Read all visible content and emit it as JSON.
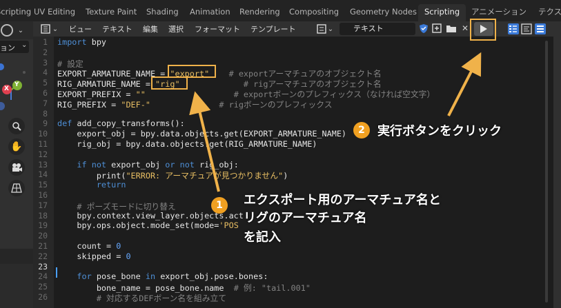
{
  "workspace_tabs": [
    {
      "label": "Scripting",
      "active": false
    },
    {
      "label": "UV Editing",
      "active": false
    },
    {
      "label": "Texture Paint",
      "active": false
    },
    {
      "label": "Shading",
      "active": false
    },
    {
      "label": "Animation",
      "active": false
    },
    {
      "label": "Rendering",
      "active": false
    },
    {
      "label": "Compositing",
      "active": false
    },
    {
      "label": "Geometry Nodes",
      "active": false
    },
    {
      "label": "Scripting",
      "active": true
    },
    {
      "label": "アニメーション",
      "active": false
    },
    {
      "label": "テクス",
      "active": false
    }
  ],
  "left_panel": {
    "mode_label": "ョン",
    "axis_labels": [
      "X",
      "Y"
    ]
  },
  "editor_menu": [
    "ビュー",
    "テキスト",
    "編集",
    "選択",
    "フォーマット",
    "テンプレート"
  ],
  "text_name": "テキスト",
  "code_lines": [
    {
      "n": "1",
      "html": "<span class='kw'>import</span> bpy"
    },
    {
      "n": "2",
      "html": ""
    },
    {
      "n": "3",
      "html": "<span class='cm'># 設定</span>"
    },
    {
      "n": "4",
      "html": "EXPORT_ARMATURE_NAME = <span class='st'>\"export\"</span>    <span class='cm'># exportアーマチュアのオブジェクト名</span>"
    },
    {
      "n": "5",
      "html": "RIG_ARMATURE_NAME = <span class='st'>\"rig\"</span>             <span class='cm'># rigアーマチュアのオブジェクト名</span>"
    },
    {
      "n": "6",
      "html": "EXPORT_PREFIX = <span class='st'>\"\"</span>                  <span class='cm'># exportボーンのプレフィックス（なければ空文字）</span>"
    },
    {
      "n": "7",
      "html": "RIG_PREFIX = <span class='st'>\"DEF-\"</span>              <span class='cm'># rigボーンのプレフィックス</span>"
    },
    {
      "n": "8",
      "html": ""
    },
    {
      "n": "9",
      "html": "<span class='kw'>def</span> add_copy_transforms():"
    },
    {
      "n": "10",
      "html": "    export_obj = bpy.data.objects.get(EXPORT_ARMATURE_NAME)"
    },
    {
      "n": "11",
      "html": "    rig_obj = bpy.data.objects.get(RIG_ARMATURE_NAME)"
    },
    {
      "n": "12",
      "html": ""
    },
    {
      "n": "13",
      "html": "    <span class='kw'>if not</span> export_obj <span class='kw'>or not</span> rig_obj:"
    },
    {
      "n": "14",
      "html": "        print(<span class='st'>\"ERROR: アーマチュアが見つかりません\"</span>)"
    },
    {
      "n": "15",
      "html": "        <span class='kw'>return</span>"
    },
    {
      "n": "16",
      "html": ""
    },
    {
      "n": "17",
      "html": "    <span class='cm'># ポーズモードに切り替え</span>"
    },
    {
      "n": "18",
      "html": "    bpy.context.view_layer.objects.act"
    },
    {
      "n": "19",
      "html": "    bpy.ops.object.mode_set(mode=<span class='st'>'POS</span>"
    },
    {
      "n": "20",
      "html": ""
    },
    {
      "n": "21",
      "html": "    count = <span class='nm'>0</span>"
    },
    {
      "n": "22",
      "html": "    skipped = <span class='nm'>0</span>"
    },
    {
      "n": "23",
      "html": ""
    },
    {
      "n": "24",
      "html": "    <span class='kw'>for</span> pose_bone <span class='kw'>in</span> export_obj.pose.bones:"
    },
    {
      "n": "25",
      "html": "        bone_name = pose_bone.name  <span class='cm'># 例: \"tail.001\"</span>"
    },
    {
      "n": "26",
      "html": "        <span class='cm'># 対応するDEFボーン名を組み立て</span>"
    }
  ],
  "annotations": {
    "step1": {
      "number": "1",
      "lines": [
        "エクスポート用のアーマチュア名と",
        "リグのアーマチュア名",
        "を記入"
      ]
    },
    "step2": {
      "number": "2",
      "text": "実行ボタンをクリック"
    }
  },
  "colors": {
    "accent": "#f0a021",
    "highlight": "#f0b24a"
  }
}
